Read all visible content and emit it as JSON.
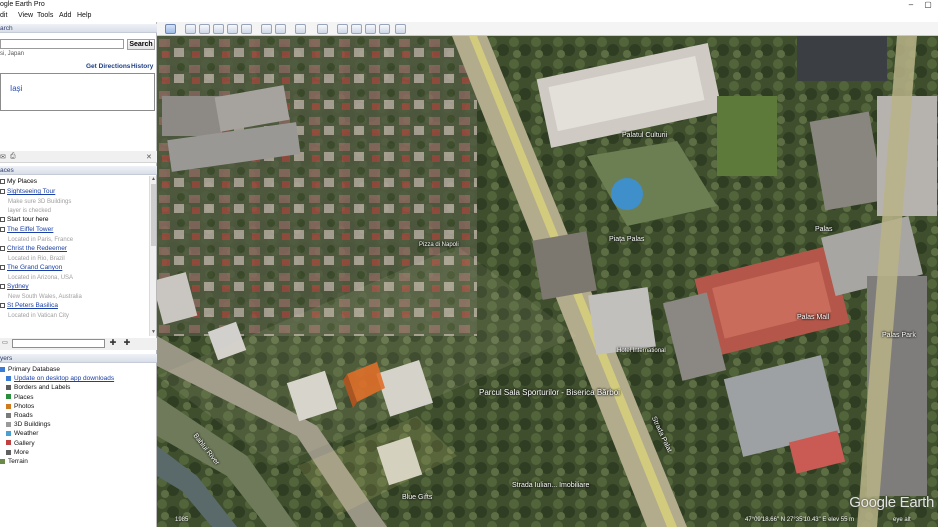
{
  "app": {
    "title": "ogle Earth Pro"
  },
  "menu": [
    "dit",
    "View",
    "Tools",
    "Add",
    "Help"
  ],
  "search": {
    "header": "arch",
    "input_value": "",
    "button": "Search",
    "location_hint": "si, Japan",
    "get_directions": "Get Directions",
    "history": "History",
    "result": "Iași"
  },
  "places": {
    "header": "aces",
    "items": [
      {
        "label": "My Places",
        "kind": "plain"
      },
      {
        "label": "Sightseeing Tour",
        "kind": "link"
      },
      {
        "label": "Make sure 3D Buildings",
        "kind": "sub"
      },
      {
        "label": "layer is checked",
        "kind": "sub"
      },
      {
        "label": "Start tour here",
        "kind": "plain"
      },
      {
        "label": "The Eiffel Tower",
        "kind": "link"
      },
      {
        "label": "Located in Paris, France",
        "kind": "sub"
      },
      {
        "label": "Christ the Redeemer",
        "kind": "link"
      },
      {
        "label": "Located in Rio, Brazil",
        "kind": "sub"
      },
      {
        "label": "The Grand Canyon",
        "kind": "link"
      },
      {
        "label": "Located in Arizona, USA",
        "kind": "sub"
      },
      {
        "label": "Sydney",
        "kind": "link"
      },
      {
        "label": "New South Wales, Australia",
        "kind": "sub"
      },
      {
        "label": "St Peters Basilica",
        "kind": "link"
      },
      {
        "label": "Located in Vatican City",
        "kind": "sub"
      }
    ]
  },
  "layers": {
    "header": "yers",
    "items": [
      {
        "label": "Primary Database",
        "kind": "plain",
        "icon": "globe-icon"
      },
      {
        "label": "Update on desktop app downloads",
        "kind": "link",
        "icon": "info-icon"
      },
      {
        "label": "Borders and Labels",
        "kind": "plain",
        "icon": "borders-icon"
      },
      {
        "label": "Places",
        "kind": "plain",
        "icon": "places-icon"
      },
      {
        "label": "Photos",
        "kind": "plain",
        "icon": "photos-icon"
      },
      {
        "label": "Roads",
        "kind": "plain",
        "icon": "roads-icon"
      },
      {
        "label": "3D Buildings",
        "kind": "plain",
        "icon": "buildings-icon"
      },
      {
        "label": "Weather",
        "kind": "plain",
        "icon": "weather-icon"
      },
      {
        "label": "Gallery",
        "kind": "plain",
        "icon": "gallery-icon"
      },
      {
        "label": "More",
        "kind": "plain",
        "icon": "more-icon"
      },
      {
        "label": "Terrain",
        "kind": "plain",
        "icon": "terrain-icon"
      }
    ]
  },
  "map_labels": [
    {
      "text": "Palatul Culturii",
      "size": 7
    },
    {
      "text": "Palas",
      "size": 7
    },
    {
      "text": "Piața Palas",
      "size": 7
    },
    {
      "text": "Palas Mall",
      "size": 7
    },
    {
      "text": "Pizza di Napoli",
      "size": 6
    },
    {
      "text": "Parcul Sala Sporturilor - Biserica Bărboi",
      "size": 8
    },
    {
      "text": "Bahlui River",
      "size": 7
    },
    {
      "text": "Blue Gifts",
      "size": 7
    },
    {
      "text": "Strada Iulian... Imobiliare",
      "size": 7
    },
    {
      "text": "Hotel International",
      "size": 6
    },
    {
      "text": "Palas Park",
      "size": 7
    },
    {
      "text": "Strada Palat",
      "size": 7
    }
  ],
  "status": {
    "year": "1985",
    "coords": "47°09'18.66\" N   27°35'10.43\" E   elev 55 m",
    "eye_alt": "eye alt"
  },
  "watermark": "Google Earth",
  "colors": {
    "link": "#1a3fa6",
    "panel_header": "#2d3d6e",
    "building_highlight": "#e0621b"
  }
}
